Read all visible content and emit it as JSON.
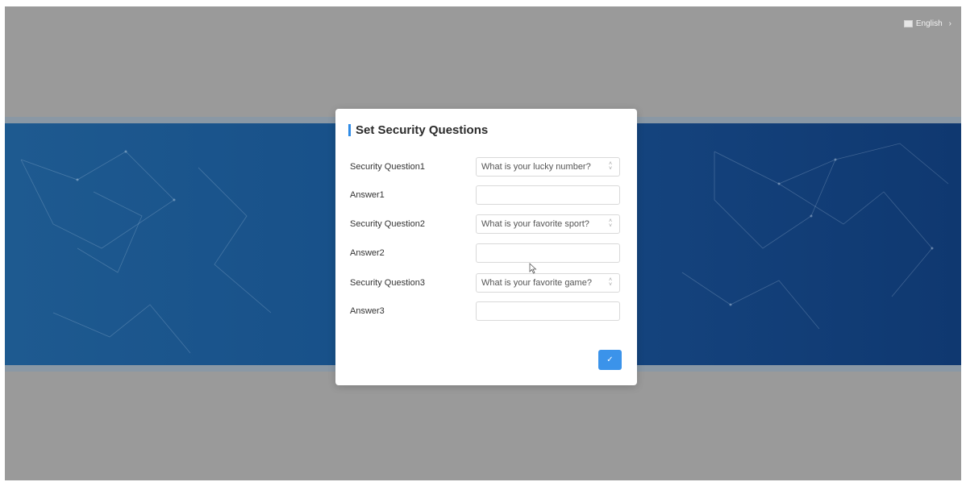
{
  "header": {
    "language_label": "English",
    "language_icon": "flag-icon",
    "chevron_icon": "chevron-right-icon"
  },
  "dialog": {
    "title": "Set Security Questions",
    "rows": [
      {
        "label": "Security Question1",
        "type": "select",
        "value": "What is your lucky number?"
      },
      {
        "label": "Answer1",
        "type": "input",
        "value": ""
      },
      {
        "label": "Security Question2",
        "type": "select",
        "value": "What is your favorite sport?"
      },
      {
        "label": "Answer2",
        "type": "input",
        "value": ""
      },
      {
        "label": "Security Question3",
        "type": "select",
        "value": "What is your favorite game?"
      },
      {
        "label": "Answer3",
        "type": "input",
        "value": ""
      }
    ],
    "confirm_icon": "check-icon"
  },
  "colors": {
    "accent": "#3b93ea",
    "band": "#174f88",
    "overlay": "#9a9a9a"
  }
}
